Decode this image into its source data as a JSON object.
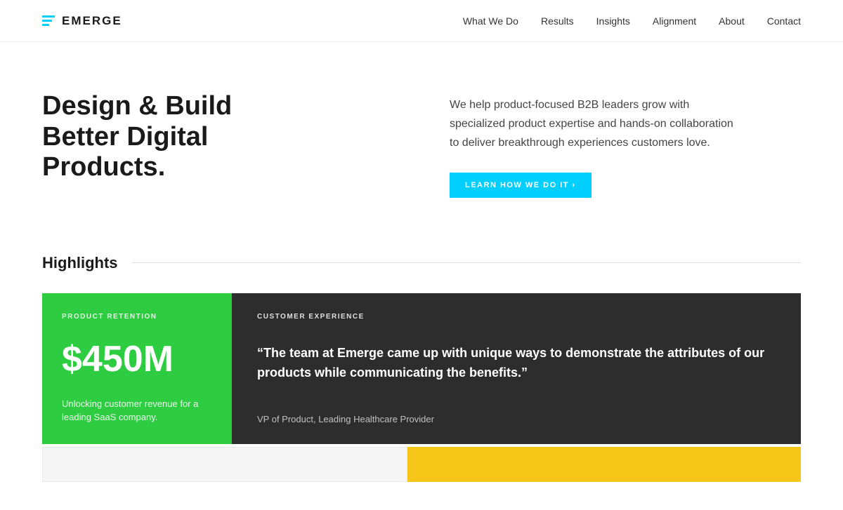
{
  "header": {
    "logo_text": "EMERGE",
    "nav_items": [
      {
        "label": "What We Do",
        "href": "#"
      },
      {
        "label": "Results",
        "href": "#"
      },
      {
        "label": "Insights",
        "href": "#"
      },
      {
        "label": "Alignment",
        "href": "#"
      },
      {
        "label": "About",
        "href": "#"
      },
      {
        "label": "Contact",
        "href": "#"
      }
    ]
  },
  "hero": {
    "title": "Design & Build Better Digital Products.",
    "description": "We help product-focused B2B leaders grow with specialized product expertise and hands-on collaboration to deliver breakthrough experiences customers love.",
    "cta_label": "LEARN HOW WE DO IT ›"
  },
  "highlights": {
    "section_title": "Highlights",
    "cards": [
      {
        "type": "stat",
        "category": "PRODUCT RETENTION",
        "stat": "$450M",
        "description": "Unlocking customer revenue for a leading SaaS company."
      },
      {
        "type": "quote",
        "category": "CUSTOMER EXPERIENCE",
        "quote": "“The team at Emerge came up with unique ways to demonstrate the attributes of our products while communicating the benefits.”",
        "attribution": "VP of Product, Leading Healthcare Provider"
      }
    ]
  },
  "colors": {
    "accent_cyan": "#00cfff",
    "card_green": "#2ecc40",
    "card_dark": "#2d2d2d",
    "card_yellow": "#f5c518"
  }
}
